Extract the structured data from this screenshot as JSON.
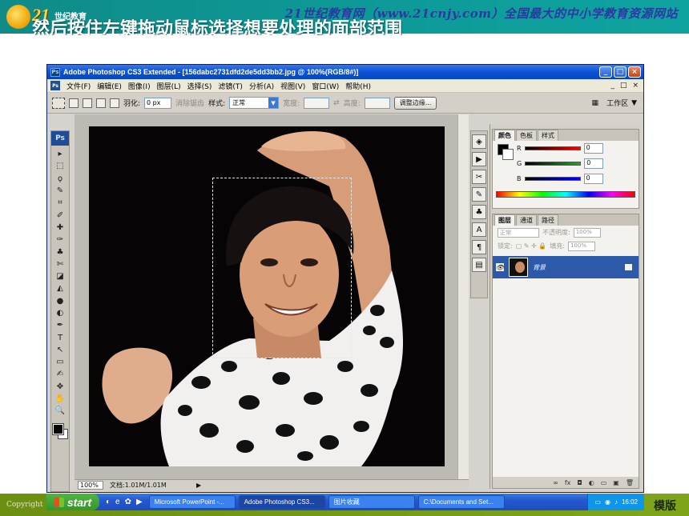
{
  "slide": {
    "logo_brand": "21",
    "logo_sub": "世纪教育",
    "site_title": "21世纪教育网（www.21cnjy.com）全国最大的中小学教育资源网站",
    "instruction": "然后按住左键拖动鼠标选择想要处理的面部范围",
    "copyright": "Copyright",
    "template_text": "模版"
  },
  "window": {
    "title": "Adobe Photoshop CS3 Extended - [156dabc2731dfd2de5dd3bb2.jpg @ 100%(RGB/8#)]",
    "ps_badge": "Ps",
    "buttons": {
      "minimize": "_",
      "maximize": "□",
      "close": "×"
    }
  },
  "menubar": {
    "items": [
      "文件(F)",
      "编辑(E)",
      "图像(I)",
      "图层(L)",
      "选择(S)",
      "滤镜(T)",
      "分析(A)",
      "视图(V)",
      "窗口(W)",
      "帮助(H)"
    ],
    "doc_controls": [
      "_",
      "□",
      "×"
    ]
  },
  "options": {
    "feather_label": "羽化:",
    "feather_value": "0 px",
    "antialias_label": "消除锯齿",
    "style_label": "样式:",
    "style_value": "正常",
    "width_label": "宽度:",
    "height_label": "高度:",
    "refine_button": "调整边缘...",
    "workspace_label": "工作区",
    "workspace_arrow": "▼"
  },
  "toolbox": {
    "badge": "Ps",
    "tools": [
      "▸",
      "⬚",
      "ϙ",
      "✎",
      "⌗",
      "✐",
      "✚",
      "✑",
      "♣",
      "✄",
      "◪",
      "◭",
      "●",
      "◐",
      "✒",
      "T",
      "↖",
      "▭",
      "✍",
      "✥",
      "✋",
      "🔍"
    ]
  },
  "status": {
    "zoom": "100%",
    "doc_info": "文档:1.01M/1.01M"
  },
  "color_panel": {
    "tabs": [
      "颜色",
      "色板",
      "样式"
    ],
    "channels": [
      {
        "label": "R",
        "value": "0",
        "color": "#ff0000"
      },
      {
        "label": "G",
        "value": "0",
        "color": "#00c000"
      },
      {
        "label": "B",
        "value": "0",
        "color": "#0000ff"
      }
    ]
  },
  "layers_panel": {
    "tabs": [
      "图层",
      "通道",
      "路径"
    ],
    "blend_mode": "正常",
    "opacity_label": "不透明度:",
    "opacity_value": "100%",
    "lock_label": "锁定:",
    "fill_label": "填充:",
    "fill_value": "100%",
    "layer_name": "背景",
    "bottom_icons": [
      "∞",
      "fx",
      "◘",
      "◐",
      "▭",
      "▣",
      "🗑"
    ]
  },
  "taskbar": {
    "start_label": "start",
    "quick_launch": [
      "◐",
      "e",
      "✿",
      "▶"
    ],
    "tasks": [
      {
        "label": "Microsoft PowerPoint -...",
        "active": false
      },
      {
        "label": "Adobe Photoshop CS3...",
        "active": true
      },
      {
        "label": "图片收藏",
        "active": false
      },
      {
        "label": "C:\\Documents and Set...",
        "active": false
      }
    ],
    "clock": "16:02"
  },
  "colors": {
    "slide_top": "#0d9b99",
    "slide_bottom": "#7ea51a",
    "xp_blue": "#2458d0",
    "selected_layer": "#2c59a8"
  }
}
